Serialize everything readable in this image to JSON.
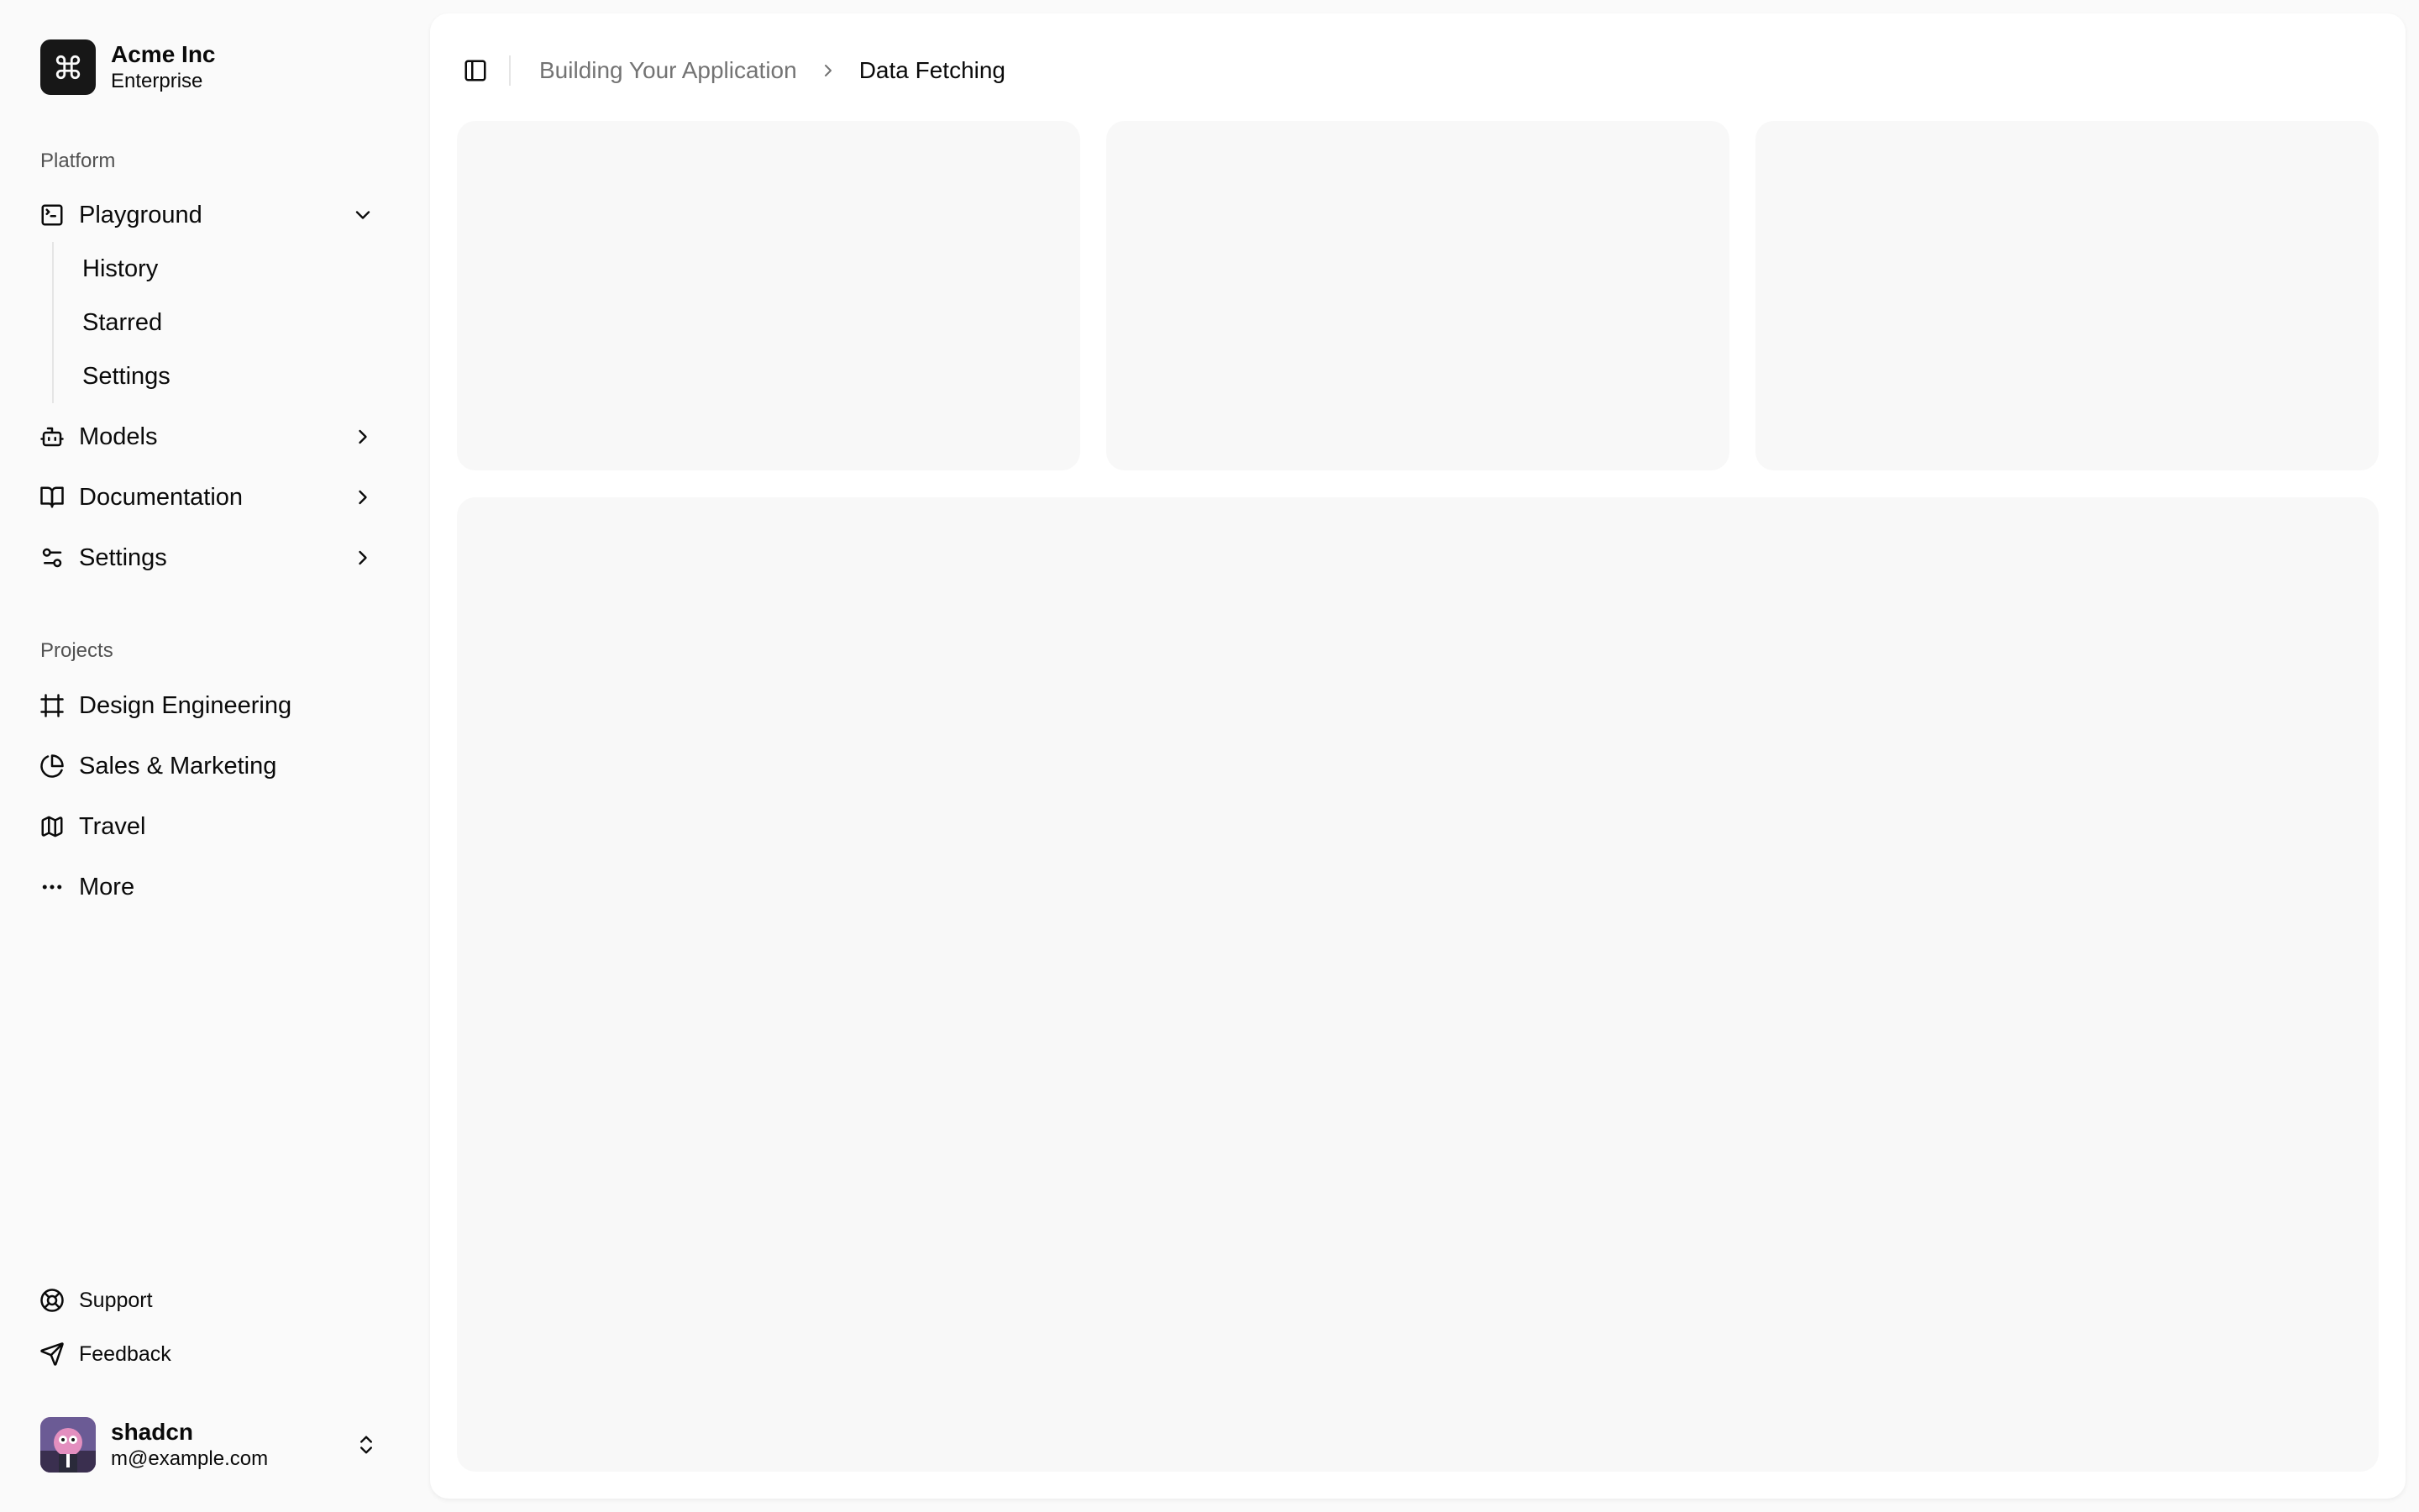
{
  "team": {
    "name": "Acme Inc",
    "plan": "Enterprise",
    "logo_icon": "command-icon"
  },
  "sidebar": {
    "platform_label": "Platform",
    "platform_items": [
      {
        "label": "Playground",
        "icon": "terminal-square-icon",
        "expanded": true,
        "children": [
          "History",
          "Starred",
          "Settings"
        ]
      },
      {
        "label": "Models",
        "icon": "bot-icon"
      },
      {
        "label": "Documentation",
        "icon": "book-open-icon"
      },
      {
        "label": "Settings",
        "icon": "settings-sliders-icon"
      }
    ],
    "projects_label": "Projects",
    "project_items": [
      {
        "label": "Design Engineering",
        "icon": "frame-icon"
      },
      {
        "label": "Sales & Marketing",
        "icon": "pie-chart-icon"
      },
      {
        "label": "Travel",
        "icon": "map-icon"
      },
      {
        "label": "More",
        "icon": "more-horizontal-icon"
      }
    ],
    "secondary_items": [
      {
        "label": "Support",
        "icon": "life-buoy-icon"
      },
      {
        "label": "Feedback",
        "icon": "send-icon"
      }
    ]
  },
  "user": {
    "name": "shadcn",
    "email": "m@example.com"
  },
  "breadcrumb": {
    "parent": "Building Your Application",
    "current": "Data Fetching"
  },
  "colors": {
    "background": "#fafafa",
    "panel": "#ffffff",
    "placeholder": "#f7f7f7",
    "muted_text": "#737373",
    "logo_bg": "#171717"
  }
}
